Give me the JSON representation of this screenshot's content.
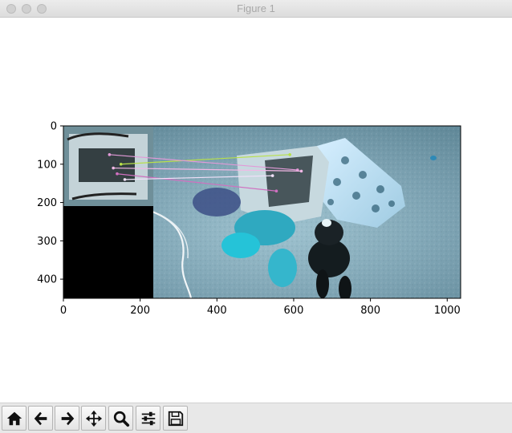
{
  "window": {
    "title": "Figure 1"
  },
  "toolbar": {
    "buttons": [
      {
        "name": "home-button",
        "icon": "home-icon"
      },
      {
        "name": "back-button",
        "icon": "arrow-left-icon"
      },
      {
        "name": "forward-button",
        "icon": "arrow-right-icon"
      },
      {
        "name": "pan-button",
        "icon": "move-icon"
      },
      {
        "name": "zoom-button",
        "icon": "magnifier-icon"
      },
      {
        "name": "configure-subplots-button",
        "icon": "sliders-icon"
      },
      {
        "name": "save-button",
        "icon": "floppy-disk-icon"
      }
    ]
  },
  "chart_data": {
    "type": "image",
    "xlim": [
      0,
      1035
    ],
    "ylim": [
      450,
      0
    ],
    "xticks": [
      0,
      200,
      400,
      600,
      800,
      1000
    ],
    "yticks": [
      0,
      100,
      200,
      300,
      400
    ],
    "xtick_labels": [
      "0",
      "200",
      "400",
      "600",
      "800",
      "1000"
    ],
    "ytick_labels": [
      "0",
      "100",
      "200",
      "300",
      "400"
    ],
    "left_image_extent": {
      "width": 235,
      "height": 210
    },
    "matches": [
      {
        "x1": 150,
        "y1": 100,
        "x2": 590,
        "y2": 75,
        "color": "#b8e04a"
      },
      {
        "x1": 120,
        "y1": 75,
        "x2": 610,
        "y2": 115,
        "color": "#e29ad8"
      },
      {
        "x1": 130,
        "y1": 110,
        "x2": 620,
        "y2": 118,
        "color": "#f2b8e6"
      },
      {
        "x1": 140,
        "y1": 125,
        "x2": 555,
        "y2": 170,
        "color": "#d070c0"
      },
      {
        "x1": 160,
        "y1": 140,
        "x2": 545,
        "y2": 130,
        "color": "#f0e0f8"
      }
    ],
    "colors": {
      "carpet": "#7fa7b6",
      "left_panel": "#6f8f99",
      "black_pad": "#000000"
    }
  }
}
